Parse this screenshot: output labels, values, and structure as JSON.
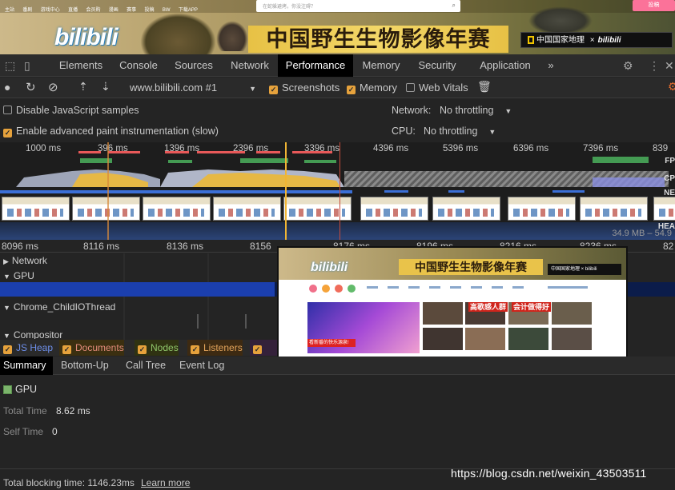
{
  "banner": {
    "topnav": [
      "主站",
      "番剧",
      "游戏中心",
      "直播",
      "会员购",
      "漫画",
      "赛事",
      "投稿",
      "BW",
      "下载APP"
    ],
    "search_placeholder": "在蛇躲避烤，你没注碍？",
    "logo": "bilibili",
    "contest_title": "中国野生生物影像年赛",
    "partner": "中国国家地理",
    "partner_x": "×",
    "partner_logo": "bilibili",
    "login": "投稿"
  },
  "devtools": {
    "tabs": [
      "Elements",
      "Console",
      "Sources",
      "Network",
      "Performance",
      "Memory",
      "Security",
      "Application"
    ],
    "active_tab": "Performance",
    "more": "»"
  },
  "toolbar": {
    "url": "www.bilibili.com #1",
    "screenshots": "Screenshots",
    "memory": "Memory",
    "web_vitals": "Web Vitals"
  },
  "settings": {
    "disable_js_samples": "Disable JavaScript samples",
    "advanced_paint": "Enable advanced paint instrumentation (slow)",
    "network_label": "Network:",
    "network_value": "No throttling",
    "cpu_label": "CPU:",
    "cpu_value": "No throttling"
  },
  "overview": {
    "ticks": [
      "1000 ms",
      "396 ms",
      "1396 ms",
      "2396 ms",
      "3396 ms",
      "4396 ms",
      "5396 ms",
      "6396 ms",
      "7396 ms",
      "839"
    ],
    "side_labels": [
      "FP",
      "CP",
      "NE",
      "HEA"
    ],
    "heap_range": "34.9 MB – 54.9"
  },
  "ruler": {
    "ticks": [
      "8096 ms",
      "8116 ms",
      "8136 ms",
      "8156",
      "8176 ms",
      "8196 ms",
      "8216 ms",
      "8236 ms",
      "82"
    ]
  },
  "tracks": {
    "network": "Network",
    "gpu": "GPU",
    "child_io": "Chrome_ChildIOThread",
    "compositor": "Compositor"
  },
  "legend": [
    "JS Heap",
    "Documents",
    "Nodes",
    "Listeners",
    "GP"
  ],
  "summary_tabs": [
    "Summary",
    "Bottom-Up",
    "Call Tree",
    "Event Log"
  ],
  "details": {
    "title": "GPU",
    "total_time_label": "Total Time",
    "total_time_value": "8.62 ms",
    "self_time_label": "Self Time",
    "self_time_value": "0"
  },
  "footer": {
    "blocking": "Total blocking time: 1146.23ms",
    "learn_more": "Learn more"
  },
  "popup": {
    "logo": "bilibili",
    "title": "中国野生生物影像年赛",
    "partner": "中国国家地理 × bilibili",
    "hero_caption": "看新番的快乐源泉!",
    "tile_captions": [
      "高歌感人群",
      "会计做得好"
    ]
  },
  "watermark": "https://blog.csdn.net/weixin_43503511",
  "colors": {
    "accent_checkbox": "#e6a23c",
    "bili_pink": "#fb7299",
    "gpu_swatch": "#7bb46b"
  }
}
